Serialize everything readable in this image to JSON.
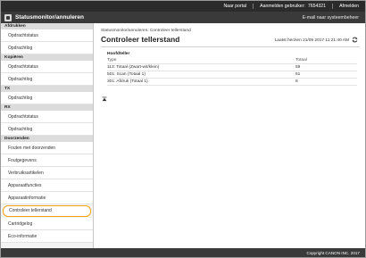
{
  "topbar": {
    "portal_link": "Naar portal",
    "logged_in_label": "Aanmelden gebruiker:",
    "user_id": "7654321",
    "logout": "Afmelden"
  },
  "header": {
    "title": "Statusmonitor/annuleren",
    "email_link": "E-mail naar systeembeheer"
  },
  "sidebar": {
    "sections": [
      {
        "label": "Afdrukken",
        "items": [
          "Opdrachtstatus",
          "Opdrachtlog"
        ]
      },
      {
        "label": "Kopiëren",
        "items": [
          "Opdrachtstatus",
          "Opdrachtlog"
        ]
      },
      {
        "label": "TX",
        "items": [
          "Opdrachtlog"
        ]
      },
      {
        "label": "RX",
        "items": [
          "Opdrachtstatus",
          "Opdrachtlog"
        ]
      },
      {
        "label": "Doorzenden",
        "items": [
          "Fouten met doorzenden",
          "Foutgegevens",
          "Verbruiksartikelen",
          "Apparaatfuncties",
          "Apparaatinformatie",
          "Controleer tellerstand",
          "Cartridgelog",
          "Eco-informatie"
        ]
      }
    ],
    "active_item": "Controleer tellerstand"
  },
  "main": {
    "breadcrumb": "Statusmonitor/annuleren: Controleer tellerstand",
    "title": "Controleer tellerstand",
    "last_updated": "Laatst herzien 21/09 2017 11:21:40 AM",
    "table_title": "Hoofdteller",
    "columns": [
      "Type",
      "Totaal"
    ],
    "rows": [
      {
        "type": "113: Totaal (Zwart-wit/klein)",
        "total": "59"
      },
      {
        "type": "501: Scan (Totaal 1)",
        "total": "51"
      },
      {
        "type": "301: Afdruk (Totaal 1)",
        "total": "8"
      }
    ]
  },
  "footer": {
    "copyright": "Copyright CANON INC. 2017"
  },
  "colors": {
    "highlight": "#f2a312",
    "header": "#3a3a3a",
    "topstrip": "#2b2b2b"
  },
  "icons": [
    "refresh-icon",
    "back-to-top-icon",
    "app-logo-icon"
  ]
}
